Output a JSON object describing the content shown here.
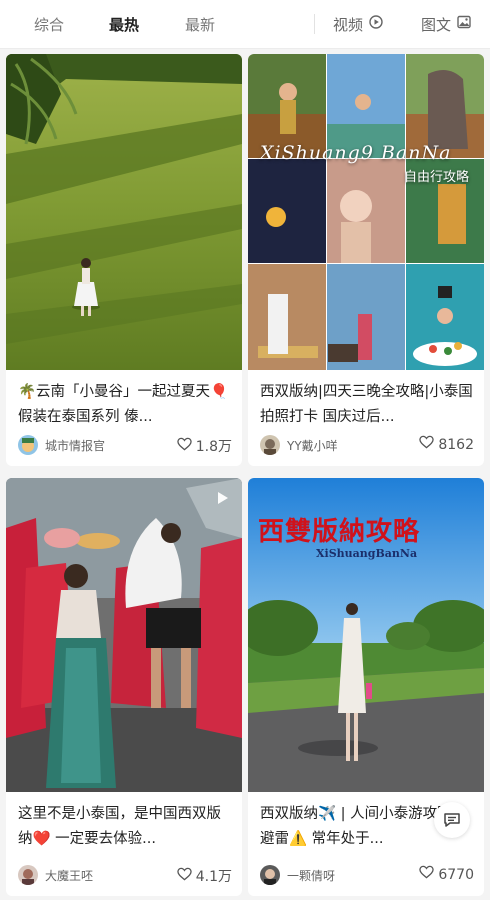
{
  "tabs": [
    {
      "label": "综合"
    },
    {
      "label": "最热"
    },
    {
      "label": "最新"
    }
  ],
  "filters": [
    {
      "label": "视频",
      "icon": "play-circle-icon"
    },
    {
      "label": "图文",
      "icon": "image-icon"
    }
  ],
  "cards": [
    {
      "title": "🌴云南「小曼谷」一起过夏天🎈假装在泰国系列 傣...",
      "author": "城市情报官",
      "likes": "1.8万"
    },
    {
      "title": "西双版纳|四天三晚全攻略|小泰国拍照打卡 国庆过后...",
      "author": "YY戴小咩",
      "likes": "8162",
      "overlay_script": "XiShuang9 BanNa",
      "overlay_caption": "自由行攻略"
    },
    {
      "title": "这里不是小泰国，是中国西双版纳❤️ 一定要去体验...",
      "author": "大魔王呸",
      "likes": "4.1万"
    },
    {
      "title": "西双版纳✈️ | 人间小泰游攻略 | 避雷⚠️ 常年处于...",
      "author": "一颗倩呀",
      "likes": "6770",
      "overlay_heading": "西雙版納攻略",
      "overlay_sub": "XiShuangBanNa"
    }
  ],
  "colors": {
    "background": "#f4f4f4",
    "card": "#ffffff",
    "active_tab": "#222222",
    "inactive_tab": "#777777",
    "red_heading": "#d0121b"
  }
}
